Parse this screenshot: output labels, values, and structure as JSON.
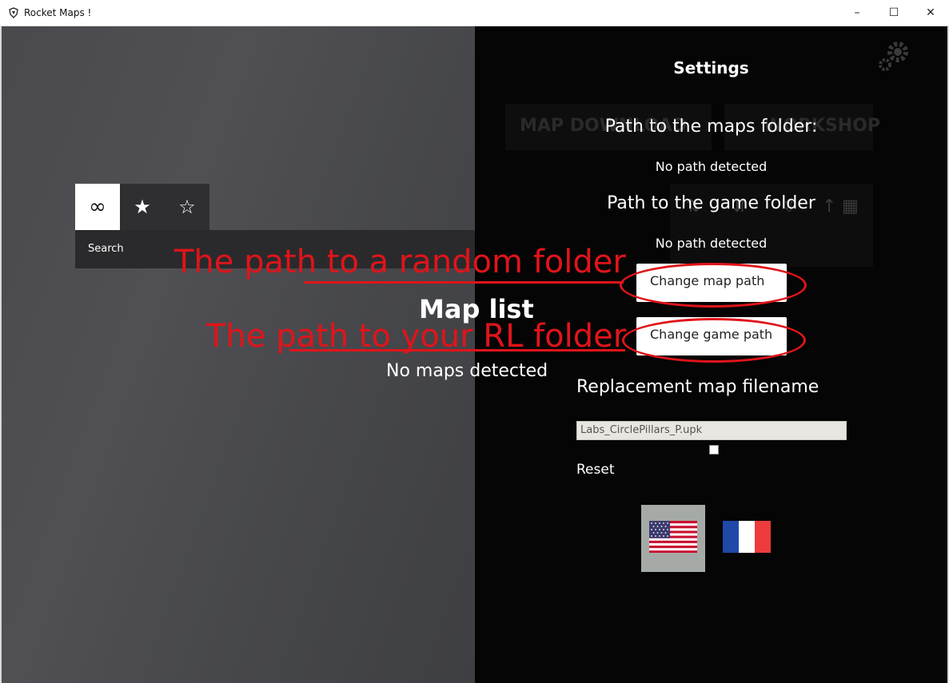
{
  "window": {
    "app_icon": "rocket-icon",
    "title": "Rocket Maps !",
    "controls": {
      "minimize": "–",
      "maximize": "☐",
      "close": "✕"
    }
  },
  "main": {
    "filters": {
      "all_icon": "∞",
      "favorites_icon": "★",
      "non_favorites_icon": "☆"
    },
    "search_label": "Search",
    "map_list_title": "Map list",
    "no_maps": "No maps detected",
    "background_buttons": [
      "MAP DOWNLOAD",
      "WORKSHOP"
    ]
  },
  "settings": {
    "title": "Settings",
    "maps_folder_heading": "Path to the maps folder:",
    "maps_folder_value": "No path detected",
    "game_folder_heading": "Path to the game folder",
    "game_folder_value": "No path detected",
    "change_map_path": "Change map path",
    "change_game_path": "Change game path",
    "replacement_label": "Replacement map filename",
    "replacement_value": "Labs_CirclePillars_P.upk",
    "reset": "Reset",
    "languages": [
      "English",
      "Français"
    ]
  },
  "annotations": {
    "map_path_note": "The path to a random folder",
    "game_path_note": "The path to your RL folder",
    "color": "#e0141a"
  }
}
